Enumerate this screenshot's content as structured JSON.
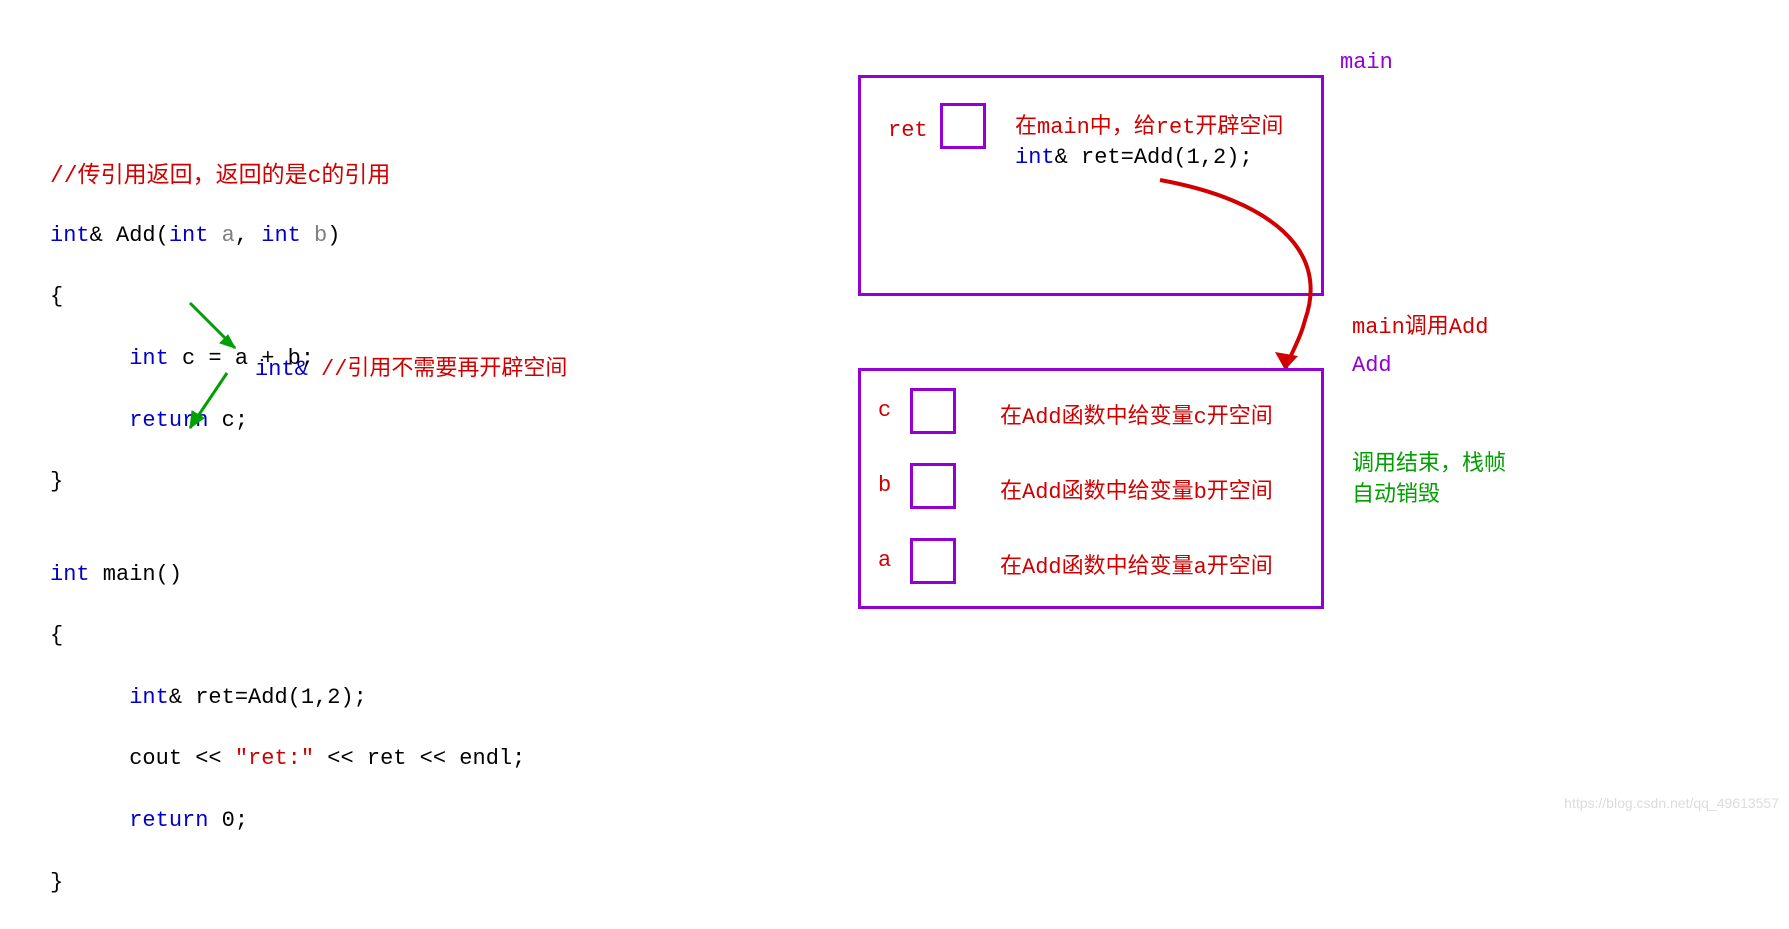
{
  "left": {
    "comment_top": "//传引用返回，返回的是c的引用",
    "code": {
      "l1_int_amp": "int",
      "l1_amp": "&",
      "l1_add": " Add(",
      "l1_int_a": "int",
      "l1_a": " a",
      "l1_comma": ", ",
      "l1_int_b": "int",
      "l1_b": " b",
      "l1_close": ")",
      "l2": "{",
      "l3_tab": "      ",
      "l3_int": "int",
      "l3_rest": " c = a + b;",
      "l4_tab": "      ",
      "l4_return": "return",
      "l4_rest": " c;",
      "l5": "}",
      "l6": "",
      "l7_int": "int",
      "l7_main": " main()",
      "l8": "{",
      "l9_tab": "      ",
      "l9_int": "int",
      "l9_amp": "&",
      "l9_rest": " ret=Add(1,2);",
      "l10_tab": "      ",
      "l10_cout": "cout << ",
      "l10_str": "\"ret:\"",
      "l10_rest": " << ret << endl;",
      "l11_tab": "      ",
      "l11_return": "return",
      "l11_rest": " 0;",
      "l12": "}"
    },
    "annot_mid_blue": "int&",
    "annot_mid_red": "   //引用不需要再开辟空间"
  },
  "right": {
    "main_title": "main",
    "main_ret_label": "ret",
    "main_desc": "在main中，给ret开辟空间",
    "main_code_int": "int",
    "main_code_amp": "&",
    "main_code_rest": " ret=Add(1,2);",
    "call_label": "main调用Add",
    "add_title": "Add",
    "c_label": "c",
    "c_desc": "在Add函数中给变量c开空间",
    "b_label": "b",
    "b_desc": "在Add函数中给变量b开空间",
    "a_label": "a",
    "a_desc": "在Add函数中给变量a开空间",
    "green_note_l1": "调用结束，栈帧",
    "green_note_l2": "自动销毁"
  },
  "watermark": "https://blog.csdn.net/qq_49613557"
}
